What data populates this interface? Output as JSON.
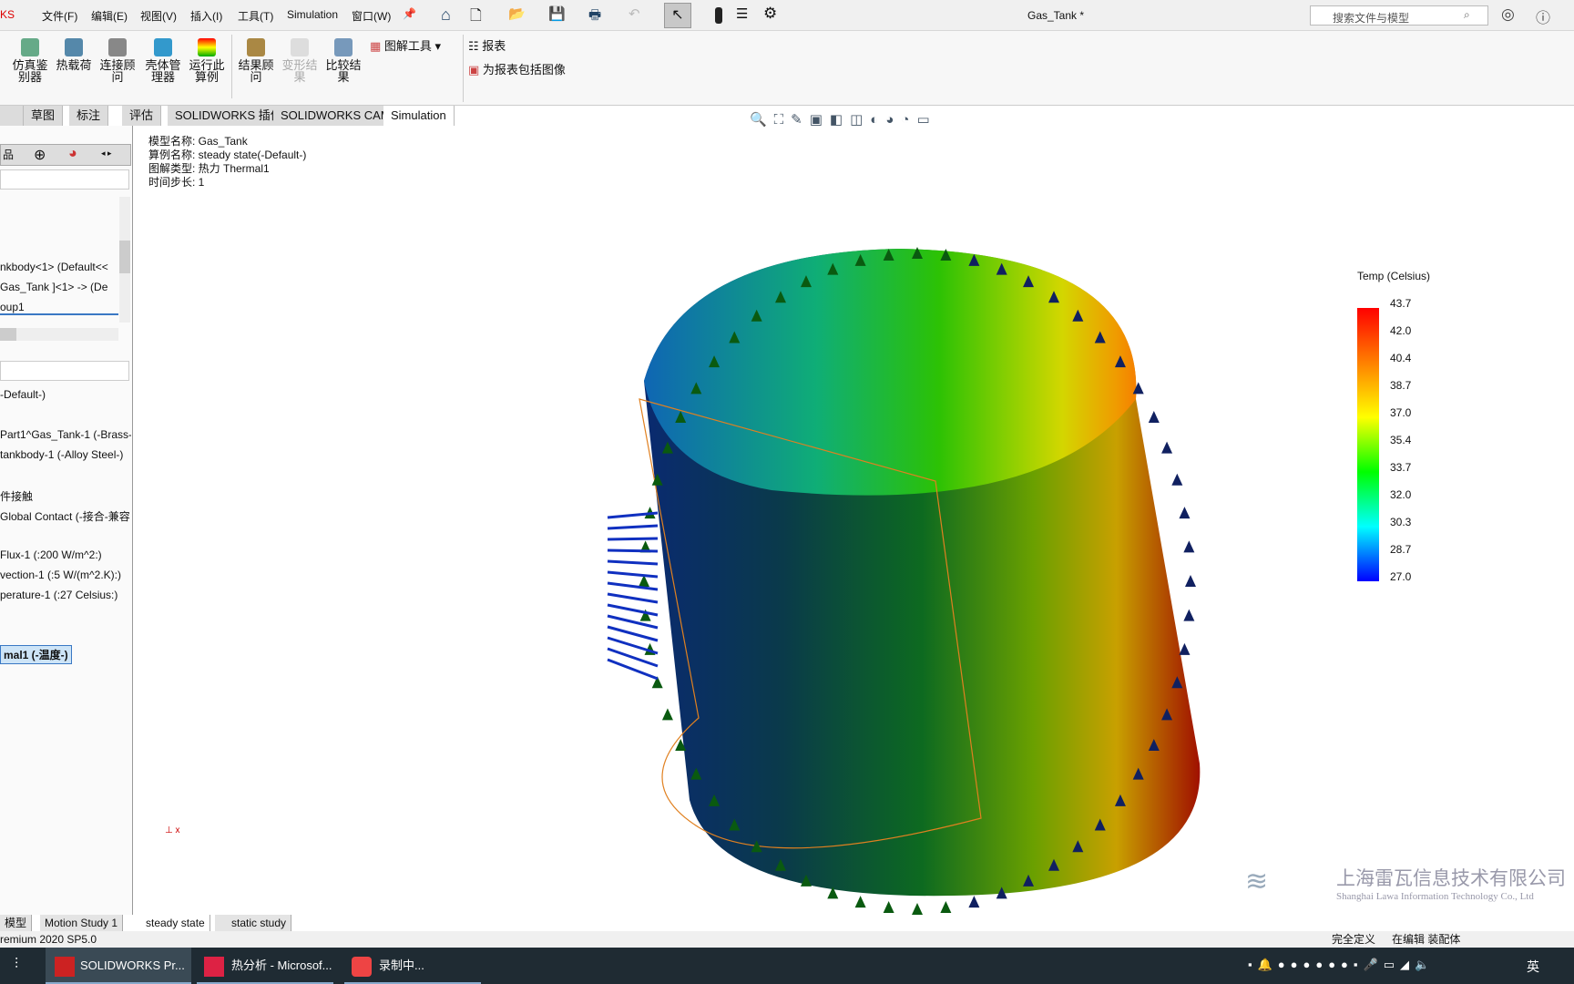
{
  "titlebar": {
    "brand": "KS",
    "menus": [
      "文件(F)",
      "编辑(E)",
      "视图(V)",
      "插入(I)",
      "工具(T)",
      "Simulation",
      "窗口(W)"
    ],
    "doc_title": "Gas_Tank *",
    "search_placeholder": "搜索文件与模型"
  },
  "ribbon": {
    "buttons": [
      "仿真鉴别器",
      "热载荷",
      "连接顾问",
      "壳体管理器",
      "运行此算例",
      "结果顾问",
      "变形结果",
      "比较结果"
    ],
    "plot_tools": "图解工具",
    "report": "报表",
    "include_image": "为报表包括图像"
  },
  "tabs": [
    "草图",
    "标注",
    "评估",
    "SOLIDWORKS 插件",
    "SOLIDWORKS CAM",
    "Simulation"
  ],
  "tree_top": [
    "nkbody<1> (Default<<",
    "Gas_Tank ]<1> -> (De",
    "oup1"
  ],
  "tree_sim": [
    "-Default-)",
    "Part1^Gas_Tank-1 (-Brass-)",
    "tankbody-1 (-Alloy Steel-)",
    "件接触",
    "Global Contact (-接合-兼容",
    "Flux-1 (:200 W/m^2:)",
    "vection-1 (:5 W/(m^2.K):)",
    "perature-1 (:27 Celsius:)",
    "mal1 (-温度-)"
  ],
  "info": {
    "model": "模型名称: Gas_Tank",
    "study": "算例名称: steady state(-Default-)",
    "plot": "图解类型: 热力 Thermal1",
    "step": "时间步长: 1"
  },
  "legend": {
    "title": "Temp (Celsius)",
    "ticks": [
      "43.7",
      "42.0",
      "40.4",
      "38.7",
      "37.0",
      "35.4",
      "33.7",
      "32.0",
      "30.3",
      "28.7",
      "27.0"
    ],
    "colors": [
      "#ff0000",
      "#ff8000",
      "#ffff00",
      "#00ff00",
      "#00ffff",
      "#0000ff"
    ]
  },
  "bottom_tabs": [
    "模型",
    "Motion Study 1",
    "steady state",
    "static study"
  ],
  "status": {
    "left": "remium 2020 SP5.0",
    "fully_defined": "完全定义",
    "editing": "在编辑 装配体"
  },
  "watermark": {
    "cn": "上海雷瓦信息技术有限公司",
    "en": "Shanghai Lawa Information Technology Co., Ltd"
  },
  "taskbar": {
    "items": [
      "SOLIDWORKS Pr...",
      "热分析 - Microsof...",
      "录制中..."
    ],
    "ime": "英"
  }
}
